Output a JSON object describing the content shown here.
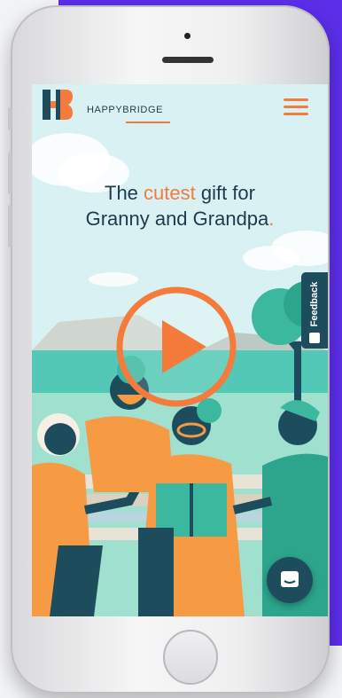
{
  "brand": {
    "name": "HAPPYBRIDGE"
  },
  "hero": {
    "headline_pre": "The ",
    "headline_accent": "cutest",
    "headline_mid": " gift for",
    "headline_line2": "Granny and Grandpa",
    "headline_period": "."
  },
  "feedback": {
    "label": "Feedback"
  },
  "icons": {
    "menu": "hamburger-icon",
    "play": "play-icon",
    "chat": "chat-icon",
    "feedback": "feedback-icon"
  },
  "colors": {
    "accent": "#f47b3c",
    "dark_teal": "#1d4d5d",
    "sky": "#d9f1f3",
    "backdrop": "#5b2ee8"
  }
}
